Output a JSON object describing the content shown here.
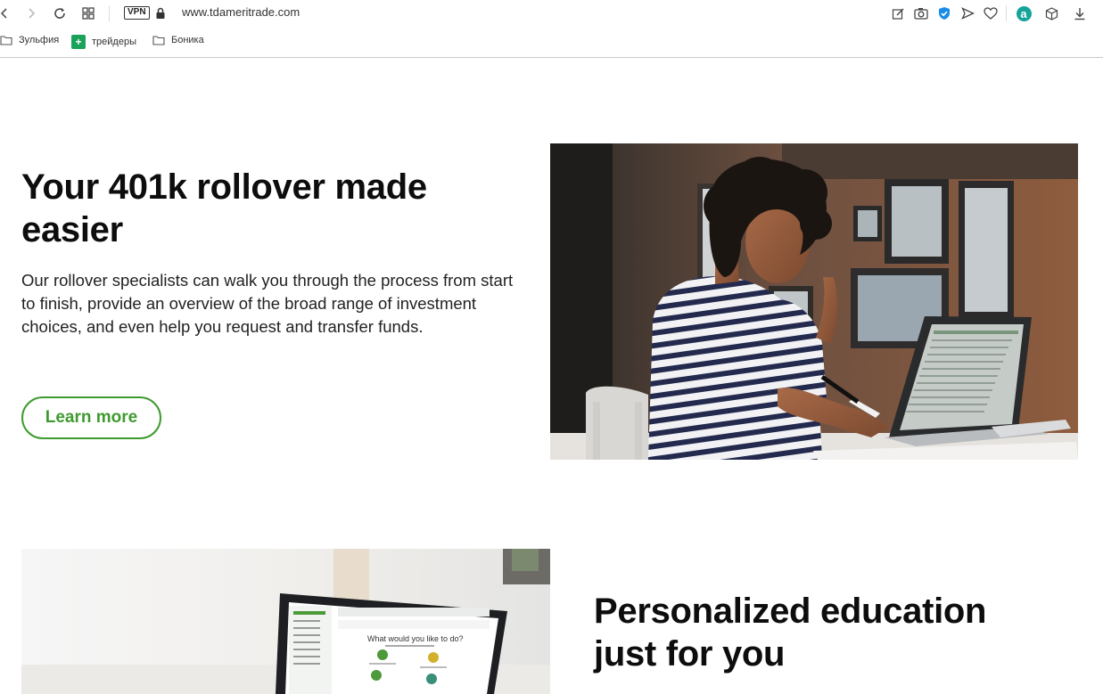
{
  "browser": {
    "vpn_label": "VPN",
    "url": "www.tdameritrade.com",
    "bookmarks": [
      {
        "label": "Зульфия",
        "icon": "folder-icon"
      },
      {
        "label": "трейдеры",
        "icon": "green-plus-icon"
      },
      {
        "label": "Боника",
        "icon": "folder-icon"
      }
    ],
    "extension_badge": "a"
  },
  "hero": {
    "title": "Your 401k rollover made easier",
    "body": "Our rollover specialists can walk you through the process from start to finish, provide an overview of the broad range of investment choices, and even help you request and transfer funds.",
    "cta": "Learn more"
  },
  "section2": {
    "title": "Personalized education just for you",
    "screen_heading": "What would you like to do?"
  },
  "colors": {
    "accent_green": "#3e9b2f",
    "text": "#0d0d0d"
  }
}
